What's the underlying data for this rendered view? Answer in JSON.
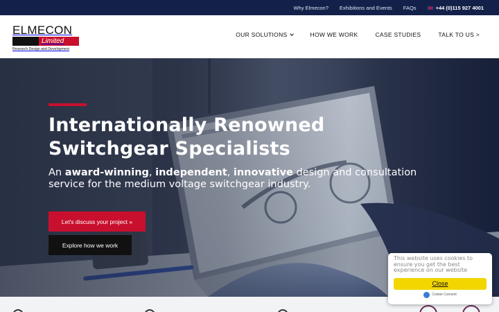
{
  "topbar": {
    "links": [
      "Why Elmecon?",
      "Exhibitions and Events",
      "FAQs"
    ],
    "phone": "+44 (0)115 927 4001"
  },
  "logo": {
    "title": "ELMECON",
    "tag": "Limited",
    "subtitle": "Research Design and Development"
  },
  "nav": {
    "items": [
      "OUR SOLUTIONS",
      "HOW WE WORK",
      "CASE STUDIES",
      "TALK TO US >"
    ]
  },
  "hero": {
    "headline": "Internationally Renowned Switchgear Specialists",
    "lede_parts": {
      "p1": "An ",
      "b1": "award-winning",
      "p2": ", ",
      "b2": "independent",
      "p3": ", ",
      "b3": "innovative",
      "p4": " design and consultation service for the medium voltage switchgear industry."
    },
    "primary_button": "Let's discuss your project »",
    "secondary_button": "Explore how we work"
  },
  "cookie": {
    "message": "This website uses cookies to ensure you get the best experience on our website",
    "button": "Close",
    "credit": "Cookie Consent"
  },
  "colors": {
    "brand_red": "#c8102e",
    "topbar_navy": "#13214a",
    "cookie_yellow": "#f1d600"
  }
}
